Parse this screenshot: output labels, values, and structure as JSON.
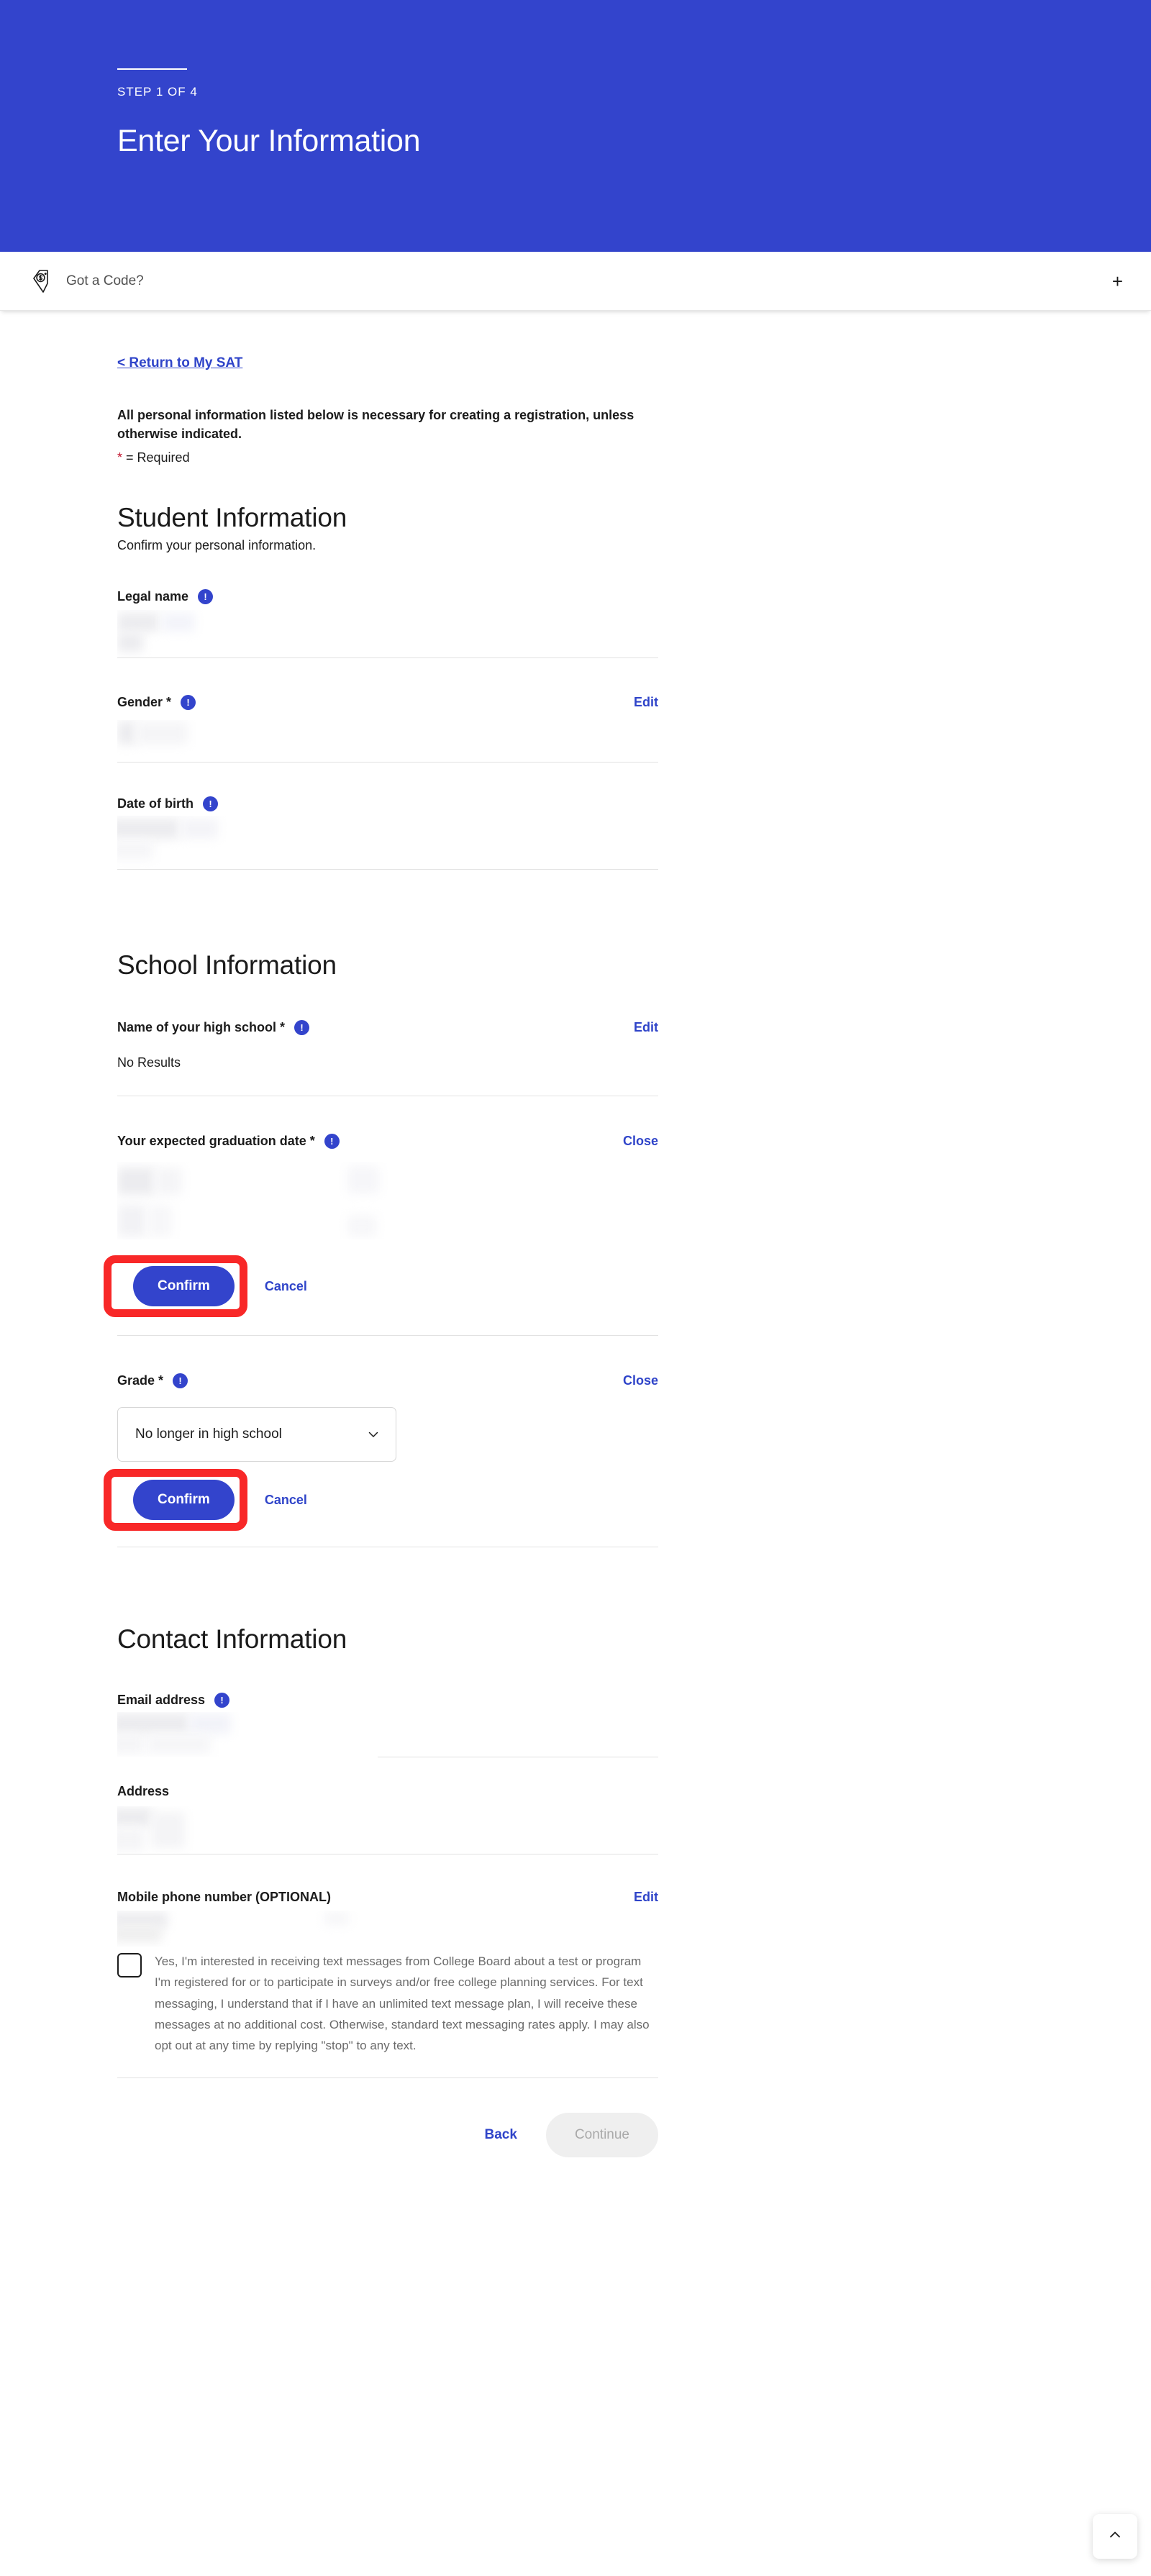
{
  "hero": {
    "step": "STEP 1 OF 4",
    "title": "Enter Your Information"
  },
  "code_bar": {
    "label": "Got a Code?",
    "expand": "+",
    "icon": "price-tag-dollar-icon"
  },
  "return_link": "< Return to My SAT",
  "notice": "All personal information listed below is necessary for creating a registration, unless otherwise indicated.",
  "required_note": {
    "star": "*",
    "text": " = Required"
  },
  "sections": {
    "student": {
      "heading": "Student Information",
      "subheading": "Confirm your personal information.",
      "fields": {
        "legal_name": {
          "label": "Legal name",
          "info": "!",
          "action": ""
        },
        "gender": {
          "label": "Gender ",
          "star": "*",
          "info": "!",
          "action": "Edit"
        },
        "dob": {
          "label": "Date of birth",
          "info": "!",
          "action": ""
        }
      }
    },
    "school": {
      "heading": "School Information",
      "fields": {
        "high_school": {
          "label": "Name of your high school ",
          "star": "*",
          "info": "!",
          "action": "Edit",
          "value": "No Results"
        },
        "grad_date": {
          "label": "Your expected graduation date ",
          "star": "*",
          "info": "!",
          "action": "Close"
        },
        "grade": {
          "label": "Grade ",
          "star": "*",
          "info": "!",
          "action": "Close",
          "selected": "No longer in high school"
        }
      },
      "grad_actions": {
        "confirm": "Confirm",
        "cancel": "Cancel"
      },
      "grade_actions": {
        "confirm": "Confirm",
        "cancel": "Cancel"
      }
    },
    "contact": {
      "heading": "Contact Information",
      "fields": {
        "email": {
          "label": "Email address",
          "info": "!",
          "action": ""
        },
        "address": {
          "label": "Address",
          "action": ""
        },
        "mobile": {
          "label": "Mobile phone number (OPTIONAL)",
          "action": "Edit"
        }
      },
      "consent": "Yes, I'm interested in receiving text messages from College Board about a test or program I'm registered for or to participate in surveys and/or free college planning services. For text messaging, I understand that if I have an unlimited text message plan, I will receive these messages at no additional cost. Otherwise, standard text messaging rates apply. I may also opt out at any time by replying \"stop\" to any text."
    }
  },
  "footer": {
    "back": "Back",
    "continue": "Continue"
  },
  "scroll_top": {
    "icon": "chevron-up-icon"
  },
  "colors": {
    "brand_blue": "#3344cc",
    "link_blue": "#2f44c9",
    "highlight_red": "#f82828",
    "required_red": "#c1122c",
    "divider": "#e2e2e2",
    "disabled_bg": "#efefef"
  }
}
